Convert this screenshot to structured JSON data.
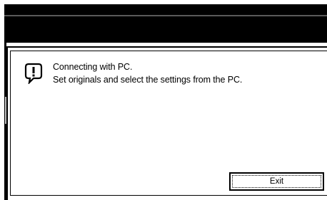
{
  "dialog": {
    "icon": "info-exclamation-icon",
    "message_line1": "Connecting with PC.",
    "message_line2": "Set originals and select the settings from the PC.",
    "exit_label": "Exit"
  },
  "colors": {
    "title_bar": "#000000",
    "background": "#ffffff",
    "border": "#000000"
  }
}
